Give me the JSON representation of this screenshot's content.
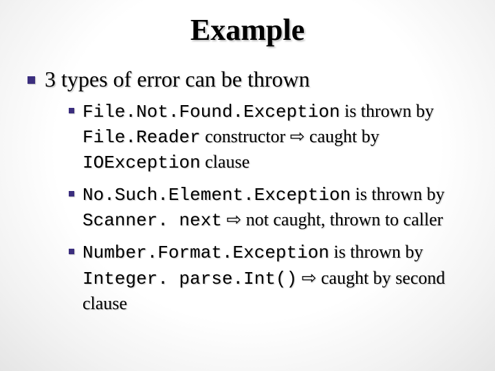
{
  "title": "Example",
  "main_bullet": "3 types of error can be thrown",
  "items": [
    {
      "code1": "File.Not.Found.Exception",
      "t1": " is thrown by ",
      "code2": "File.Reader",
      "t2": "  constructor ",
      "arrow": "⇨",
      "t3": " caught by ",
      "code3": "IOException",
      "t4": " clause"
    },
    {
      "code1": "No.Such.Element.Exception",
      "t1": " is thrown by ",
      "code2": "Scanner. next",
      "t2": " ",
      "arrow": "⇨",
      "t3": " not caught, thrown to caller",
      "code3": "",
      "t4": ""
    },
    {
      "code1": "Number.Format.Exception",
      "t1": " is thrown by ",
      "code2": "Integer. parse.Int()",
      "t2": " ",
      "arrow": "⇨",
      "t3": " caught by second clause",
      "code3": "",
      "t4": ""
    }
  ]
}
